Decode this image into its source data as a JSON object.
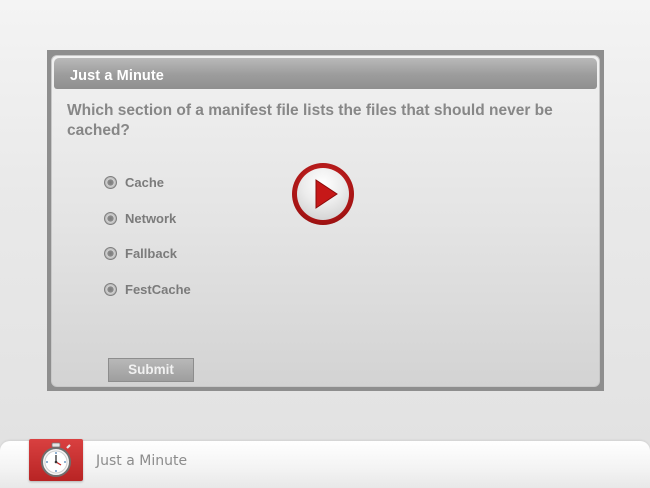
{
  "card": {
    "title": "Just a Minute",
    "question": "Which section of a manifest file lists the files that should never be cached?",
    "options": [
      {
        "label": "Cache"
      },
      {
        "label": "Network"
      },
      {
        "label": "Fallback"
      },
      {
        "label": "FestCache"
      }
    ],
    "submit_label": "Submit"
  },
  "footer": {
    "label": "Just a Minute",
    "icon": "stopwatch-icon"
  },
  "play": {
    "icon": "play-icon"
  },
  "colors": {
    "accent": "#b81c1c",
    "title_bar": "#9c9c9c",
    "text_gray": "#878787"
  }
}
